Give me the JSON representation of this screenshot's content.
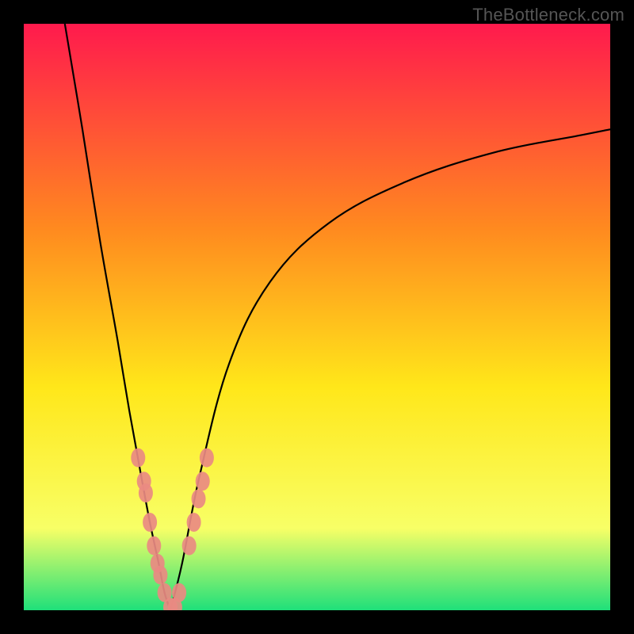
{
  "watermark": "TheBottleneck.com",
  "chart_data": {
    "type": "line",
    "title": "",
    "xlabel": "",
    "ylabel": "",
    "xlim": [
      0,
      100
    ],
    "ylim": [
      0,
      100
    ],
    "grid": false,
    "legend": false,
    "background_gradient": {
      "top": "#ff1a4d",
      "mid1": "#ff8a1f",
      "mid2": "#ffe71a",
      "lower": "#f8ff66",
      "bottom": "#1fe07a"
    },
    "series": [
      {
        "name": "left-branch",
        "type": "line",
        "x": [
          7,
          10,
          13,
          16,
          18,
          20,
          21.5,
          23,
          24,
          25
        ],
        "y": [
          100,
          82,
          63,
          46,
          34,
          23,
          15,
          8,
          3,
          0
        ]
      },
      {
        "name": "right-branch",
        "type": "line",
        "x": [
          25,
          27,
          30,
          35,
          42,
          52,
          65,
          80,
          95,
          100
        ],
        "y": [
          0,
          8,
          23,
          42,
          56,
          66,
          73,
          78,
          81,
          82
        ]
      }
    ],
    "points": {
      "name": "markers",
      "type": "scatter",
      "color": "#e98a82",
      "x": [
        19.5,
        20.5,
        20.8,
        21.5,
        22.2,
        22.8,
        23.3,
        24.0,
        25.0,
        25.8,
        26.5,
        28.2,
        29.0,
        29.8,
        30.5,
        31.2
      ],
      "y": [
        26,
        22,
        20,
        15,
        11,
        8,
        6,
        3,
        0.5,
        0.5,
        3,
        11,
        15,
        19,
        22,
        26
      ]
    }
  }
}
